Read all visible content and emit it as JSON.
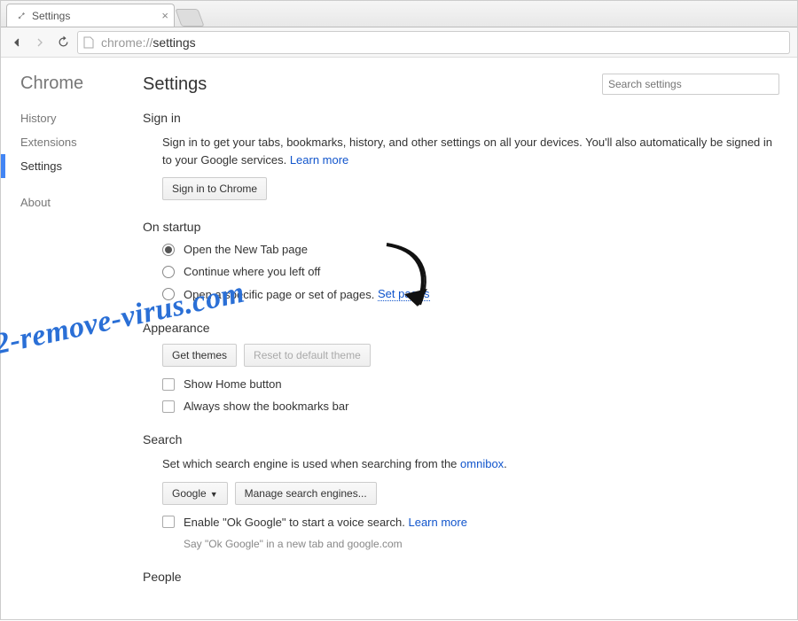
{
  "tab": {
    "title": "Settings"
  },
  "address": {
    "scheme": "chrome://",
    "path": "settings"
  },
  "sidebar": {
    "brand": "Chrome",
    "items": [
      {
        "label": "History",
        "active": false
      },
      {
        "label": "Extensions",
        "active": false
      },
      {
        "label": "Settings",
        "active": true
      },
      {
        "label": "About",
        "active": false
      }
    ]
  },
  "header": {
    "title": "Settings",
    "search_placeholder": "Search settings"
  },
  "sections": {
    "signin": {
      "title": "Sign in",
      "desc": "Sign in to get your tabs, bookmarks, history, and other settings on all your devices. You'll also automatically be signed in to your Google services.",
      "learn_more": "Learn more",
      "button": "Sign in to Chrome"
    },
    "startup": {
      "title": "On startup",
      "options": [
        {
          "label": "Open the New Tab page",
          "selected": true
        },
        {
          "label": "Continue where you left off",
          "selected": false
        },
        {
          "label": "Open a specific page or set of pages.",
          "selected": false
        }
      ],
      "set_pages": "Set pages"
    },
    "appearance": {
      "title": "Appearance",
      "get_themes": "Get themes",
      "reset_theme": "Reset to default theme",
      "show_home": "Show Home button",
      "show_bookmarks": "Always show the bookmarks bar"
    },
    "search": {
      "title": "Search",
      "desc_pre": "Set which search engine is used when searching from the ",
      "omnibox": "omnibox",
      "engine_btn": "Google",
      "manage_btn": "Manage search engines...",
      "ok_google": "Enable \"Ok Google\" to start a voice search.",
      "learn_more": "Learn more",
      "hint": "Say \"Ok Google\" in a new tab and google.com"
    },
    "people": {
      "title": "People"
    }
  },
  "watermark": "2-remove-virus.com"
}
